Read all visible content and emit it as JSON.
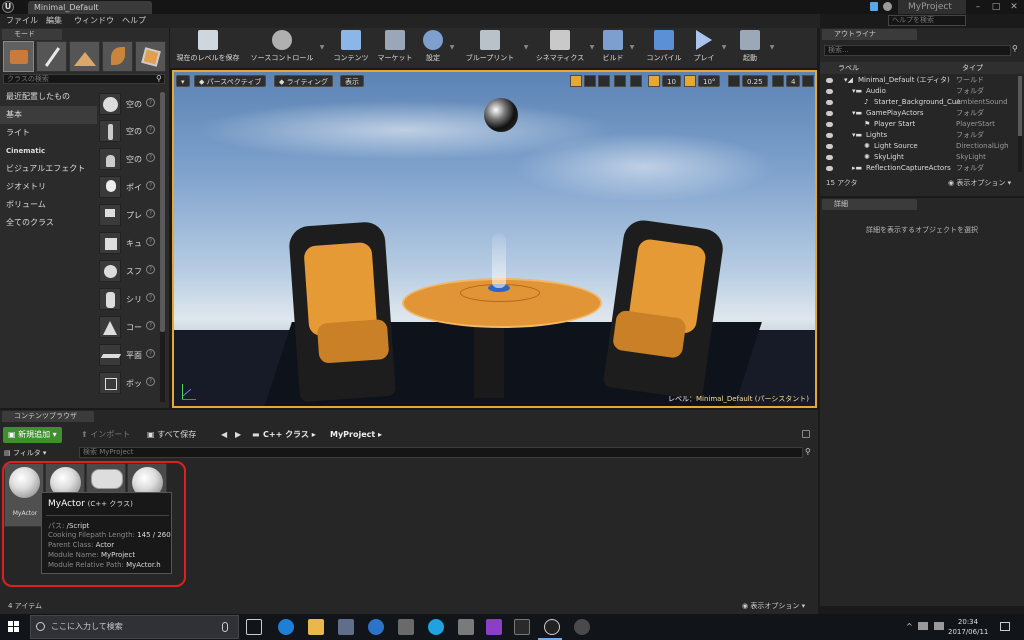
{
  "titlebar": {
    "logo": "U",
    "tab_title": "Minimal_Default",
    "project_name": "MyProject",
    "help_placeholder": "ヘルプを検索"
  },
  "menu": {
    "items": [
      "ファイル",
      "編集",
      "ウィンドウ",
      "ヘルプ"
    ]
  },
  "modes": {
    "tab": "モード",
    "search_placeholder": "クラスの検索"
  },
  "categories": [
    "最近配置したもの",
    "基本",
    "ライト",
    "Cinematic",
    "ビジュアルエフェクト",
    "ジオメトリ",
    "ボリューム",
    "全てのクラス"
  ],
  "place_items": [
    "空の",
    "空の",
    "空の",
    "ポイ",
    "プレ",
    "キュ",
    "スフ",
    "シリ",
    "コー",
    "平面",
    "ボッ"
  ],
  "toolbar": {
    "items": [
      "現在のレベルを保存",
      "ソースコントロール",
      "コンテンツ",
      "マーケット",
      "設定",
      "ブループリント",
      "シネマティクス",
      "ビルド",
      "コンパイル",
      "プレイ",
      "起動"
    ]
  },
  "viewport": {
    "perspective": "パースペクティブ",
    "lighting": "ライティング",
    "show": "表示",
    "grid_size": "10",
    "rot_snap": "10°",
    "scale_snap": "0.25",
    "cam_speed": "4",
    "level_label": "レベル：",
    "level_name": "Minimal_Default (パーシスタント)"
  },
  "outliner": {
    "tab": "アウトライナ",
    "search_placeholder": "検索...",
    "col_label": "ラベル",
    "col_type": "タイプ",
    "rows": [
      {
        "label": "Minimal_Default (エディタ)",
        "type": "ワールド"
      },
      {
        "label": "Audio",
        "type": "フォルダ"
      },
      {
        "label": "Starter_Background_Cue",
        "type": "AmbientSound"
      },
      {
        "label": "GamePlayActors",
        "type": "フォルダ"
      },
      {
        "label": "Player Start",
        "type": "PlayerStart"
      },
      {
        "label": "Lights",
        "type": "フォルダ"
      },
      {
        "label": "Light Source",
        "type": "DirectionalLigh"
      },
      {
        "label": "SkyLight",
        "type": "SkyLight"
      },
      {
        "label": "ReflectionCaptureActors",
        "type": "フォルダ"
      }
    ],
    "actor_count": "15 アクタ",
    "view_options": "表示オプション ▾"
  },
  "details": {
    "tab": "詳細",
    "empty_message": "詳細を表示するオブジェクトを選択"
  },
  "content_browser": {
    "tab": "コンテンツブラウザ",
    "add_new": "新規追加 ▾",
    "import": "インポート",
    "save_all": "すべて保存",
    "path_1": "C++ クラス",
    "path_2": "MyProject",
    "filter": "フィルタ ▾",
    "search_placeholder": "検索 MyProject",
    "first_asset_label": "MyActor",
    "item_count": "4 アイテム",
    "view_options": "表示オプション ▾"
  },
  "tooltip": {
    "title": "MyActor",
    "subtitle": "(C++ クラス)",
    "props": [
      {
        "k": "パス:",
        "v": "/Script"
      },
      {
        "k": "Cooking Filepath Length:",
        "v": "145 / 260"
      },
      {
        "k": "Parent Class:",
        "v": "Actor"
      },
      {
        "k": "Module Name:",
        "v": "MyProject"
      },
      {
        "k": "Module Relative Path:",
        "v": "MyActor.h"
      }
    ]
  },
  "taskbar": {
    "search_placeholder": "ここに入力して検索",
    "time": "20:34",
    "date": "2017/06/11"
  },
  "colors": {
    "accent_orange": "#e7a833",
    "highlight_red": "#e02020",
    "add_green": "#3f8f2f"
  }
}
